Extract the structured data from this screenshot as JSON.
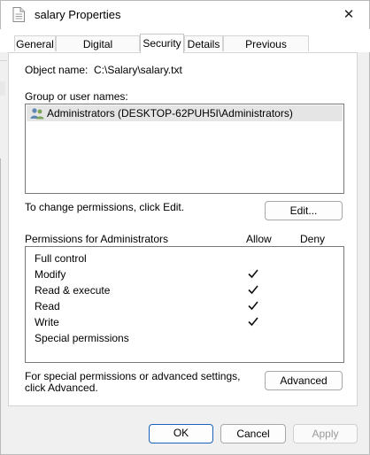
{
  "window": {
    "title": "salary Properties",
    "close_glyph": "✕"
  },
  "tabs": [
    {
      "label": "General",
      "active": false
    },
    {
      "label": "Digital Signatures",
      "active": false
    },
    {
      "label": "Security",
      "active": true
    },
    {
      "label": "Details",
      "active": false
    },
    {
      "label": "Previous Versions",
      "active": false
    }
  ],
  "security": {
    "object_name_label": "Object name:",
    "object_name_value": "C:\\Salary\\salary.txt",
    "groups_label": "Group or user names:",
    "groups": [
      {
        "name": "Administrators (DESKTOP-62PUH5I\\Administrators)",
        "icon": "users-icon",
        "selected": true
      }
    ],
    "change_hint": "To change permissions, click Edit.",
    "edit_button": "Edit...",
    "permissions_label": "Permissions for Administrators",
    "allow_header": "Allow",
    "deny_header": "Deny",
    "permissions": [
      {
        "name": "Full control",
        "allow": false,
        "deny": false
      },
      {
        "name": "Modify",
        "allow": true,
        "deny": false
      },
      {
        "name": "Read & execute",
        "allow": true,
        "deny": false
      },
      {
        "name": "Read",
        "allow": true,
        "deny": false
      },
      {
        "name": "Write",
        "allow": true,
        "deny": false
      },
      {
        "name": "Special permissions",
        "allow": false,
        "deny": false
      }
    ],
    "advanced_hint": "For special permissions or advanced settings, click Advanced.",
    "advanced_button": "Advanced"
  },
  "footer": {
    "ok": "OK",
    "cancel": "Cancel",
    "apply": "Apply"
  },
  "colors": {
    "accent": "#1a63b8",
    "selection": "#e5e5e5"
  }
}
